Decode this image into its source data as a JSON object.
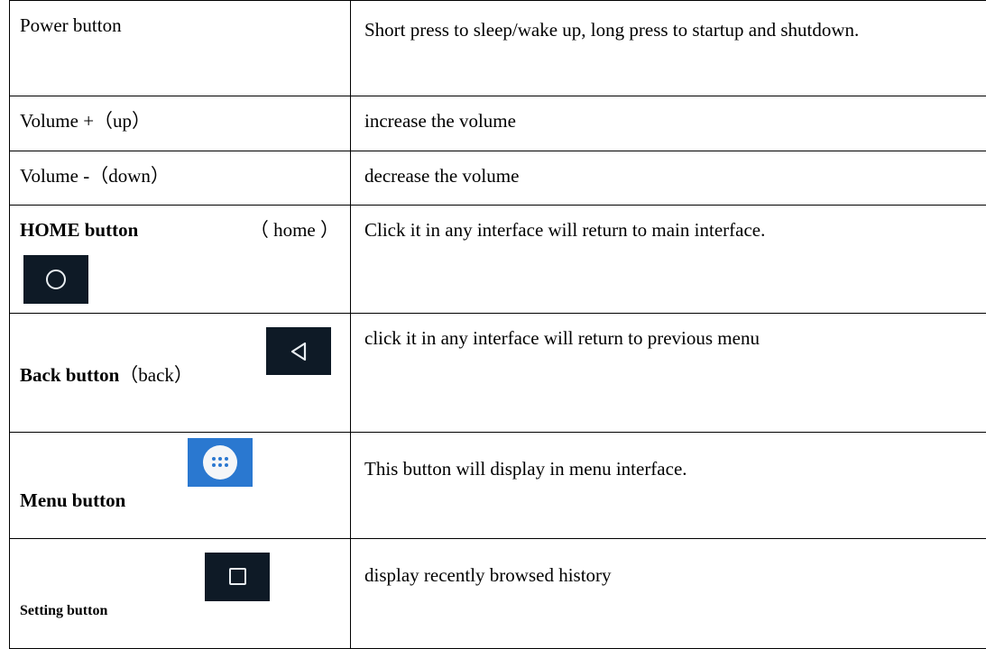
{
  "rows": [
    {
      "name": "Power button",
      "description": "Short press to sleep/wake up, long press to startup and shutdown."
    },
    {
      "name": "Volume +（up）",
      "description": "increase the volume"
    },
    {
      "name": "Volume -（down）",
      "description": "decrease the volume"
    },
    {
      "name_bold": "HOME button",
      "name_extra": "（ home ）",
      "icon": "home-circle-icon",
      "description": "Click it in any interface will return to main interface."
    },
    {
      "name_bold": "Back button",
      "name_extra": "（back）",
      "icon": "back-triangle-icon",
      "description": "click it in any interface will return to previous menu"
    },
    {
      "name_bold": "Menu button",
      "icon": "menu-grid-icon",
      "description": "This button will display in menu interface."
    },
    {
      "name_bold": "Setting button",
      "icon": "recent-square-icon",
      "description": "display recently browsed history"
    }
  ],
  "colors": {
    "icon_tile": "#0e1a26",
    "icon_glyph": "#e9eef2",
    "menu_tile": "#2a78d0",
    "border": "#000000"
  }
}
